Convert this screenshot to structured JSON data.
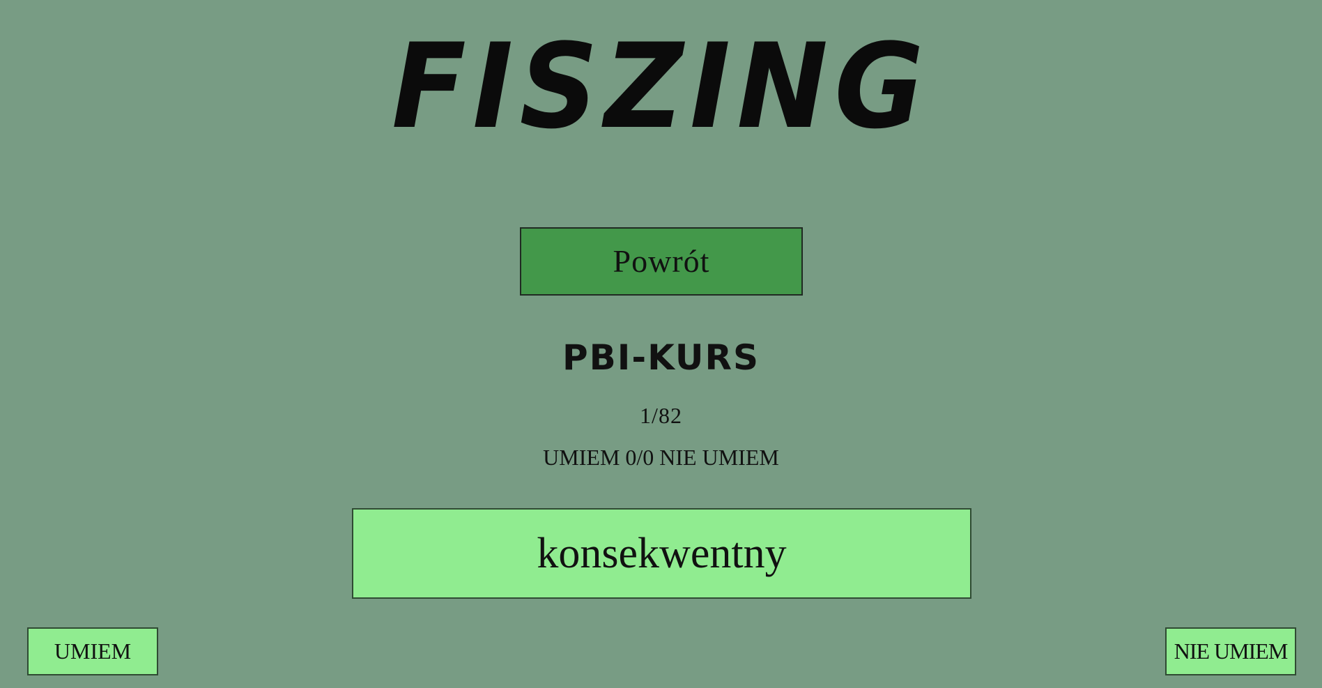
{
  "header": {
    "logo_text": "FISZING"
  },
  "controls": {
    "back_label": "Powrót"
  },
  "course": {
    "name": "PBI-KURS",
    "progress": "1/82",
    "score": "UMIEM 0/0 NIE UMIEM"
  },
  "card": {
    "word": "konsekwentny"
  },
  "answers": {
    "know_label": "UMIEM",
    "dont_know_label": "NIE UMIEM"
  },
  "colors": {
    "background": "#789c84",
    "back_button": "#43984a",
    "card": "#90ec90"
  }
}
